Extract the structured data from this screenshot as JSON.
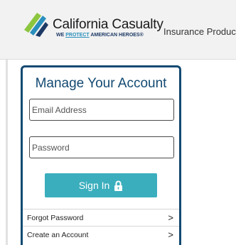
{
  "header": {
    "brand_name": "California Casualty",
    "tagline_pre": "WE ",
    "tagline_highlight": "PROTECT",
    "tagline_post": " AMERICAN HEROES",
    "tagline_mark": "®",
    "nav_link": "Insurance Product"
  },
  "login": {
    "title": "Manage Your Account",
    "email_placeholder": "Email Address",
    "password_placeholder": "Password",
    "sign_in_label": "Sign In",
    "links": [
      {
        "label": "Forgot Password",
        "icon": "chevron-right-icon"
      },
      {
        "label": "Create an Account",
        "icon": "chevron-right-icon"
      }
    ]
  },
  "colors": {
    "brand_navy": "#134a72",
    "button_teal": "#3aaebd",
    "logo_green": "#8cc63f",
    "logo_blue": "#2a8fbd"
  }
}
